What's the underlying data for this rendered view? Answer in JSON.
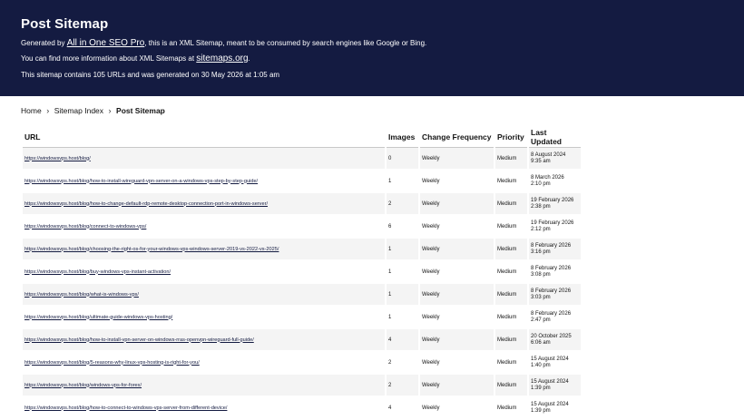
{
  "header": {
    "title": "Post Sitemap",
    "line1_pre": "Generated by ",
    "line1_link": "All in One SEO Pro",
    "line1_post": ", this is an XML Sitemap, meant to be consumed by search engines like Google or Bing.",
    "line2_pre": "You can find more information about XML Sitemaps at ",
    "line2_link": "sitemaps.org",
    "line2_post": ".",
    "line3": "This sitemap contains 105 URLs and was generated on 30 May 2026 at 1:05 am"
  },
  "breadcrumb": {
    "home": "Home",
    "index": "Sitemap Index",
    "current": "Post Sitemap"
  },
  "table": {
    "headers": {
      "url": "URL",
      "images": "Images",
      "freq": "Change Frequency",
      "priority": "Priority",
      "updated": "Last Updated"
    },
    "rows": [
      {
        "url": "https://windowsvps.host/blog/",
        "images": "0",
        "freq": "Weekly",
        "priority": "Medium",
        "date": "8 August 2024",
        "time": "9:35 am"
      },
      {
        "url": "https://windowsvps.host/blog/how-to-install-wireguard-vpn-server-on-a-windows-vps-step-by-step-guide/",
        "images": "1",
        "freq": "Weekly",
        "priority": "Medium",
        "date": "8 March 2026",
        "time": "2:10 pm"
      },
      {
        "url": "https://windowsvps.host/blog/how-to-change-default-rdp-remote-desktop-connection-port-in-windows-server/",
        "images": "2",
        "freq": "Weekly",
        "priority": "Medium",
        "date": "19 February 2026",
        "time": "2:38 pm"
      },
      {
        "url": "https://windowsvps.host/blog/connect-to-windows-vps/",
        "images": "6",
        "freq": "Weekly",
        "priority": "Medium",
        "date": "19 February 2026",
        "time": "2:12 pm"
      },
      {
        "url": "https://windowsvps.host/blog/choosing-the-right-os-for-your-windows-vps-windows-server-2019-vs-2022-vs-2025/",
        "images": "1",
        "freq": "Weekly",
        "priority": "Medium",
        "date": "8 February 2026",
        "time": "3:16 pm"
      },
      {
        "url": "https://windowsvps.host/blog/buy-windows-vps-instant-activation/",
        "images": "1",
        "freq": "Weekly",
        "priority": "Medium",
        "date": "8 February 2026",
        "time": "3:08 pm"
      },
      {
        "url": "https://windowsvps.host/blog/what-is-windows-vps/",
        "images": "1",
        "freq": "Weekly",
        "priority": "Medium",
        "date": "8 February 2026",
        "time": "3:03 pm"
      },
      {
        "url": "https://windowsvps.host/blog/ultimate-guide-windows-vps-hosting/",
        "images": "1",
        "freq": "Weekly",
        "priority": "Medium",
        "date": "8 February 2026",
        "time": "2:47 pm"
      },
      {
        "url": "https://windowsvps.host/blog/how-to-install-vpn-server-on-windows-rras-openvpn-wireguard-full-guide/",
        "images": "4",
        "freq": "Weekly",
        "priority": "Medium",
        "date": "20 October 2025",
        "time": "6:06 am"
      },
      {
        "url": "https://windowsvps.host/blog/5-reasons-why-linux-vps-hosting-is-right-for-you/",
        "images": "2",
        "freq": "Weekly",
        "priority": "Medium",
        "date": "15 August 2024",
        "time": "1:40 pm"
      },
      {
        "url": "https://windowsvps.host/blog/windows-vps-for-forex/",
        "images": "2",
        "freq": "Weekly",
        "priority": "Medium",
        "date": "15 August 2024",
        "time": "1:39 pm"
      },
      {
        "url": "https://windowsvps.host/blog/how-to-connect-to-windows-vps-server-from-different-device/",
        "images": "4",
        "freq": "Weekly",
        "priority": "Medium",
        "date": "15 August 2024",
        "time": "1:39 pm"
      }
    ]
  }
}
